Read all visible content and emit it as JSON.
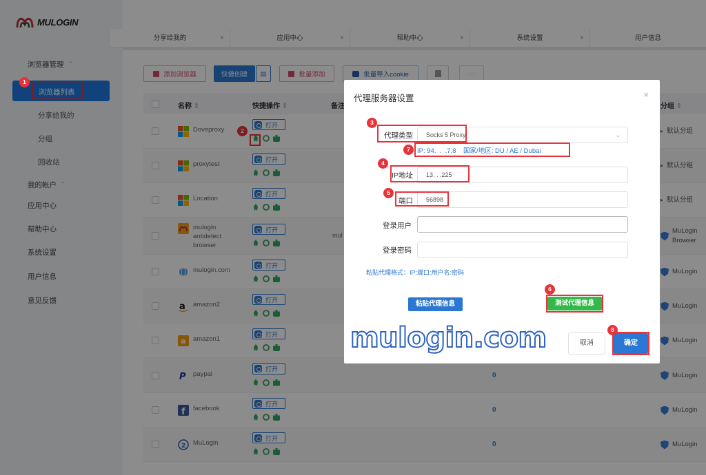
{
  "app": {
    "logo_text": "MULOGIN"
  },
  "sidebar": {
    "browser_mgmt": "浏览器管理",
    "browser_list": "浏览器列表",
    "shared_to_me": "分享给我的",
    "group": "分组",
    "recycle": "回收站",
    "my_account": "我的帐户",
    "app_center": "应用中心",
    "help_center": "帮助中心",
    "system_settings": "系统设置",
    "user_info": "用户信息",
    "feedback": "意见反馈"
  },
  "tabs": [
    "分享给我的",
    "应用中心",
    "帮助中心",
    "系统设置",
    "用户信息"
  ],
  "toolbar": {
    "add_browser": "添加浏览器",
    "quick_create": "快捷创建",
    "batch_add": "批量添加",
    "batch_import_cookie": "批量导入cookie",
    "more": "···"
  },
  "table": {
    "headers": {
      "name": "名称",
      "quick_ops": "快捷操作",
      "notes": "备注",
      "group": "分组"
    },
    "open_label": "打开",
    "rows": [
      {
        "name": "Doveproxy",
        "group": "默认分组",
        "zero": ""
      },
      {
        "name": "proxytest",
        "group": "默认分组",
        "zero": ""
      },
      {
        "name": "Location",
        "group": "默认分组",
        "zero": ""
      },
      {
        "name": "mulogin antidetect browser",
        "group": "MuLogin Browser",
        "zero": "",
        "notes": "mul"
      },
      {
        "name": "mulogin.com",
        "group": "MuLogin",
        "zero": ""
      },
      {
        "name": "amazon2",
        "group": "MuLogin",
        "zero": ""
      },
      {
        "name": "amazon1",
        "group": "MuLogin",
        "zero": ""
      },
      {
        "name": "paypal",
        "group": "MuLogin",
        "zero": "0"
      },
      {
        "name": "facebook",
        "group": "MuLogin",
        "zero": "0"
      },
      {
        "name": "MuLogin",
        "group": "MuLogin",
        "zero": "0"
      }
    ]
  },
  "modal": {
    "title": "代理服务器设置",
    "close": "×",
    "proxy_type_label": "代理类型",
    "proxy_type_value": "Socks 5 Proxy",
    "ip_info": "IP: 94.  .  .7.8    国家/地区: DU / AE / Dubai",
    "ip_label": "IP地址",
    "ip_value": "13.  .  .225",
    "port_label": "端口",
    "port_value": "56898",
    "user_label": "登录用户",
    "pass_label": "登录密码",
    "paste_hint": "粘贴代理格式：IP:端口:用户名:密码",
    "paste_btn": "粘贴代理信息",
    "test_btn": "测试代理信息",
    "cancel_btn": "取消",
    "confirm_btn": "确定"
  },
  "badges": [
    "1",
    "2",
    "3",
    "4",
    "5",
    "6",
    "7",
    "8"
  ],
  "watermark": "mulogin.com",
  "colors": {
    "accent": "#1e7be0",
    "highlight": "#e8333a",
    "test_green": "#35b84a"
  }
}
